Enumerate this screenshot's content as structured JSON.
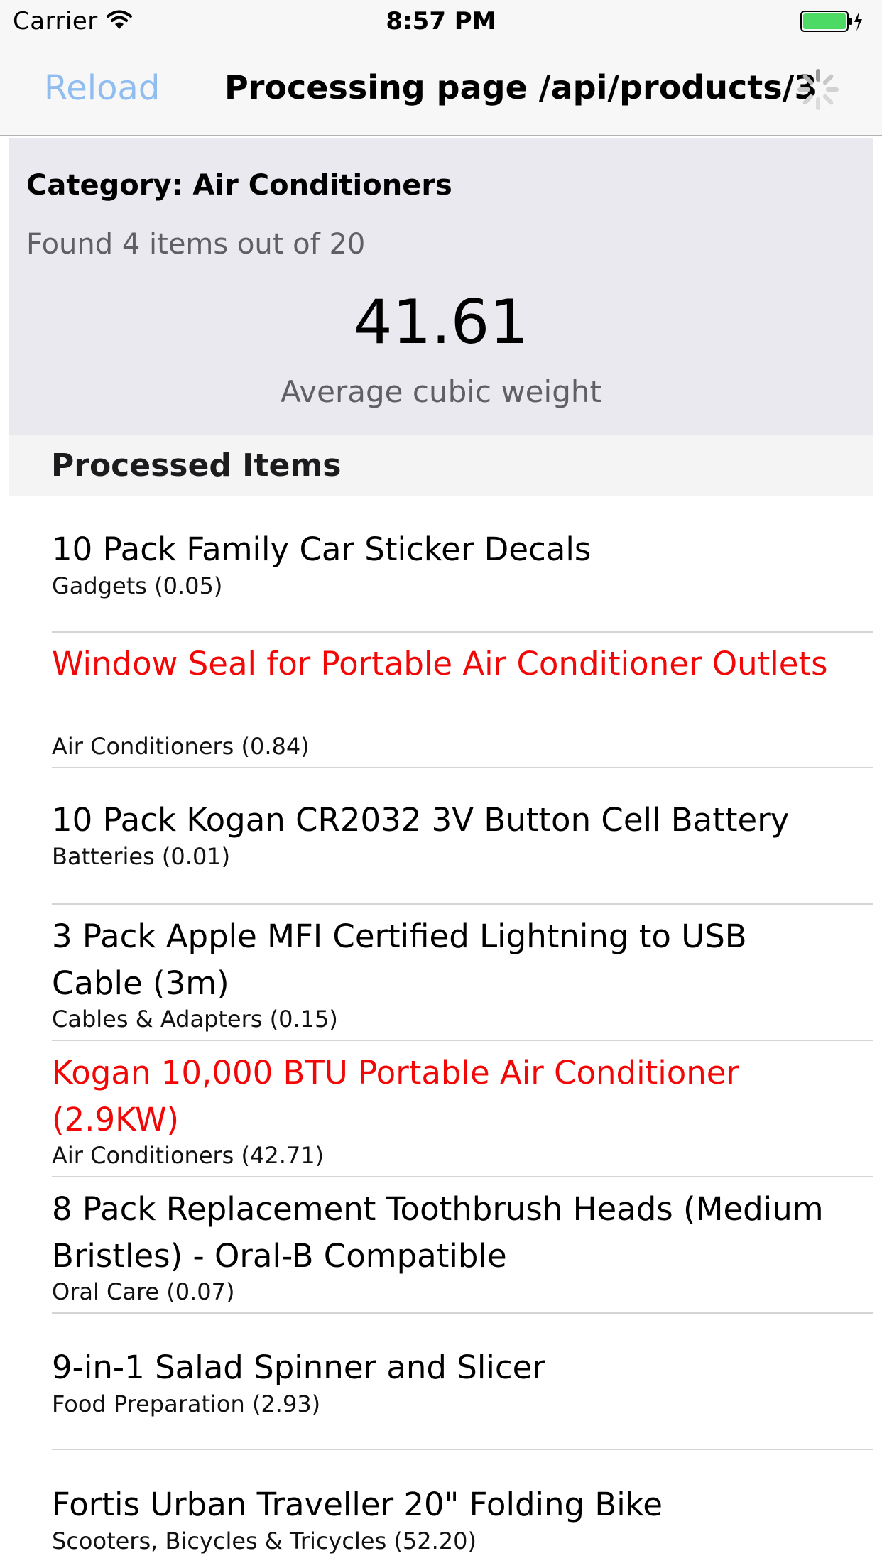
{
  "status_bar": {
    "carrier": "Carrier",
    "time": "8:57 PM",
    "wifi_icon": "wifi-icon",
    "battery_icon": "battery-charging-icon",
    "battery_color": "#4cd964"
  },
  "nav": {
    "reload_label": "Reload",
    "title": "Processing page /api/products/3",
    "activity_icon": "spinner-icon",
    "tint": "#8fbdf0"
  },
  "summary": {
    "category": "Category: Air Conditioners",
    "found": "Found 4 items out of 20",
    "value": "41.61",
    "caption": "Average cubic weight"
  },
  "section": {
    "header": "Processed Items"
  },
  "highlight_color": "#f20707",
  "items": [
    {
      "title": "10 Pack Family Car Sticker Decals",
      "subtitle": "Gadgets (0.05)",
      "highlight": false
    },
    {
      "title": "Window Seal for Portable Air Conditioner Outlets",
      "subtitle": "Air Conditioners (0.84)",
      "highlight": true
    },
    {
      "title": "10 Pack Kogan CR2032 3V Button Cell Battery",
      "subtitle": "Batteries (0.01)",
      "highlight": false
    },
    {
      "title": "3 Pack Apple MFI Certified Lightning to USB Cable (3m)",
      "subtitle": "Cables & Adapters (0.15)",
      "highlight": false
    },
    {
      "title": "Kogan 10,000 BTU Portable Air Conditioner (2.9KW)",
      "subtitle": "Air Conditioners (42.71)",
      "highlight": true
    },
    {
      "title": "8 Pack Replacement Toothbrush Heads (Medium Bristles) - Oral-B Compatible",
      "subtitle": "Oral Care (0.07)",
      "highlight": false
    },
    {
      "title": "9-in-1 Salad Spinner and Slicer",
      "subtitle": "Food Preparation (2.93)",
      "highlight": false
    },
    {
      "title": "Fortis Urban Traveller 20\" Folding Bike",
      "subtitle": "Scooters, Bicycles & Tricycles (52.20)",
      "highlight": false
    }
  ]
}
